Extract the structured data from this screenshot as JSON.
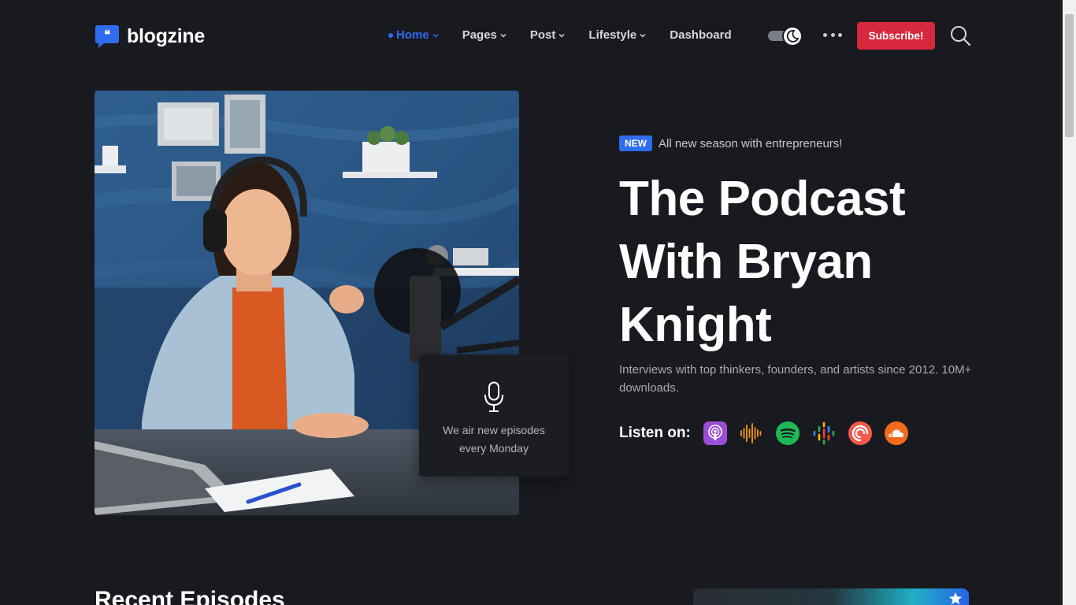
{
  "brand": {
    "name": "blogzine",
    "logo_icon": "quote-bubble-icon",
    "accent": "#2f6df0"
  },
  "nav": {
    "items": [
      {
        "label": "Home",
        "active": true,
        "has_dropdown": true
      },
      {
        "label": "Pages",
        "active": false,
        "has_dropdown": true
      },
      {
        "label": "Post",
        "active": false,
        "has_dropdown": true
      },
      {
        "label": "Lifestyle",
        "active": false,
        "has_dropdown": true
      },
      {
        "label": "Dashboard",
        "active": false,
        "has_dropdown": false
      }
    ],
    "theme_toggle": "dark-mode-toggle",
    "more_icon": "more-dots-icon",
    "subscribe_label": "Subscribe!",
    "subscribe_color": "#d6293e",
    "search_icon": "search-icon"
  },
  "hero": {
    "image_alt": "Woman with headphones speaking into a podcast microphone",
    "card_icon": "microphone-icon",
    "card_text_line1": "We air new episodes",
    "card_text_line2": "every Monday",
    "badge": "NEW",
    "badge_text": "All new season with entrepreneurs!",
    "title_line1": "The Podcast",
    "title_line2": "With Bryan",
    "title_line3": "Knight",
    "description": "Interviews with top thinkers, founders, and artists since 2012. 10M+ downloads.",
    "listen_label": "Listen on:",
    "platforms": [
      {
        "name": "apple-podcasts-icon",
        "color": "#9b4fd6"
      },
      {
        "name": "audio-wave-icon",
        "color": "#f39a1f"
      },
      {
        "name": "spotify-icon",
        "color": "#1db954"
      },
      {
        "name": "google-podcasts-icon",
        "color": "#4285f4"
      },
      {
        "name": "pocket-casts-icon",
        "color": "#f25a4a"
      },
      {
        "name": "soundcloud-icon",
        "color": "#f26b1d"
      }
    ]
  },
  "recent": {
    "title": "Recent Episodes"
  }
}
